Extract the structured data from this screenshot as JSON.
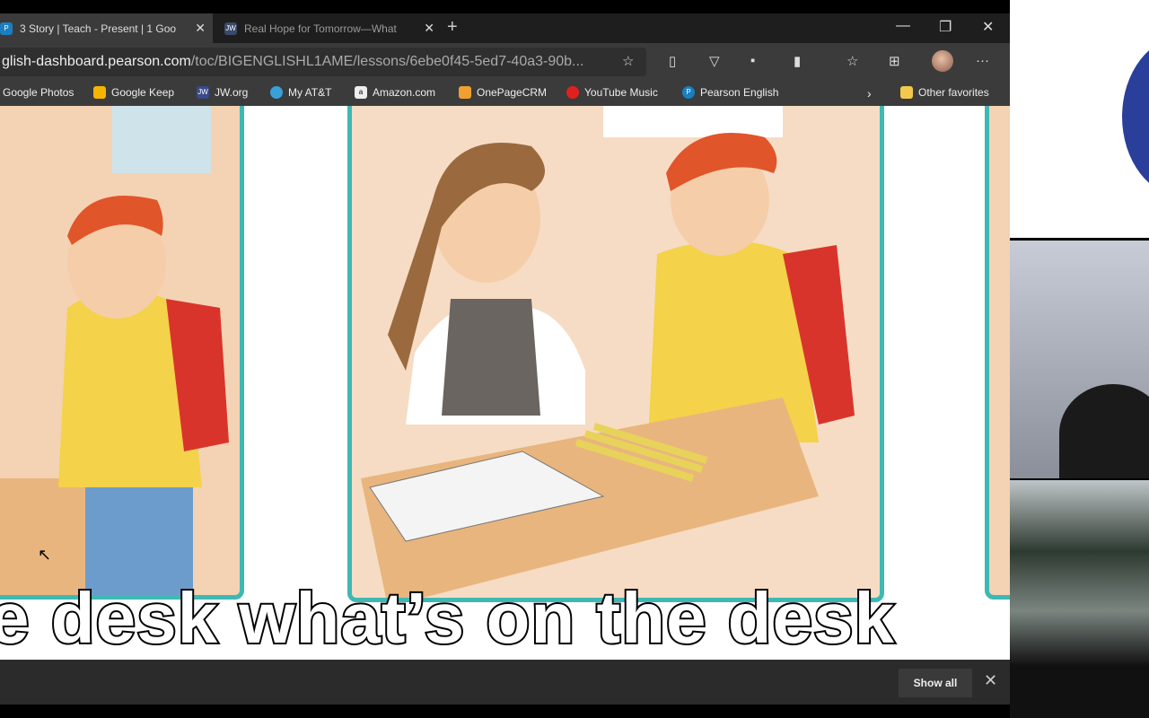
{
  "tabs": [
    {
      "title": "3 Story | Teach - Present | 1 Goo",
      "icon": "P",
      "active": true
    },
    {
      "title": "Real Hope for Tomorrow—What",
      "icon": "JW",
      "active": false
    }
  ],
  "address": {
    "host": "glish-dashboard.pearson.com",
    "path": "/toc/BIGENGLISHL1AME/lessons/6ebe0f45-5ed7-40a3-90b..."
  },
  "bookmarks": [
    {
      "label": "Google Photos",
      "color": "#888"
    },
    {
      "label": "Google Keep",
      "color": "#f4b400"
    },
    {
      "label": "JW.org",
      "color": "#3a4a8a"
    },
    {
      "label": "My AT&T",
      "color": "#3aa0d8"
    },
    {
      "label": "Amazon.com",
      "color": "#eee"
    },
    {
      "label": "OnePageCRM",
      "color": "#f0a030"
    },
    {
      "label": "YouTube Music",
      "color": "#e02020"
    },
    {
      "label": "Pearson English",
      "color": "#1a7fc0"
    }
  ],
  "other_favorites": "Other favorites",
  "caption": "e desk what’s on the desk",
  "downloads": {
    "show_all": "Show all"
  },
  "colors": {
    "panel_border": "#3fb8b4"
  }
}
